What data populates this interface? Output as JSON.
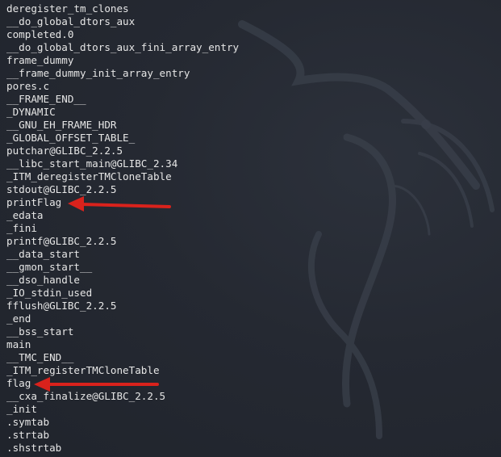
{
  "terminal": {
    "lines": [
      "deregister_tm_clones",
      "__do_global_dtors_aux",
      "completed.0",
      "__do_global_dtors_aux_fini_array_entry",
      "frame_dummy",
      "__frame_dummy_init_array_entry",
      "pores.c",
      "__FRAME_END__",
      "_DYNAMIC",
      "__GNU_EH_FRAME_HDR",
      "_GLOBAL_OFFSET_TABLE_",
      "putchar@GLIBC_2.2.5",
      "__libc_start_main@GLIBC_2.34",
      "_ITM_deregisterTMCloneTable",
      "stdout@GLIBC_2.2.5",
      "printFlag",
      "_edata",
      "_fini",
      "printf@GLIBC_2.2.5",
      "__data_start",
      "__gmon_start__",
      "__dso_handle",
      "_IO_stdin_used",
      "fflush@GLIBC_2.2.5",
      "_end",
      "__bss_start",
      "main",
      "__TMC_END__",
      "_ITM_registerTMCloneTable",
      "flag",
      "__cxa_finalize@GLIBC_2.2.5",
      "_init",
      ".symtab",
      ".strtab",
      ".shstrtab"
    ]
  },
  "annotations": {
    "arrow_color": "#d9221c",
    "arrows_point_to": [
      "printFlag",
      "flag"
    ]
  },
  "background": {
    "logo_icon": "kali-dragon-icon"
  }
}
